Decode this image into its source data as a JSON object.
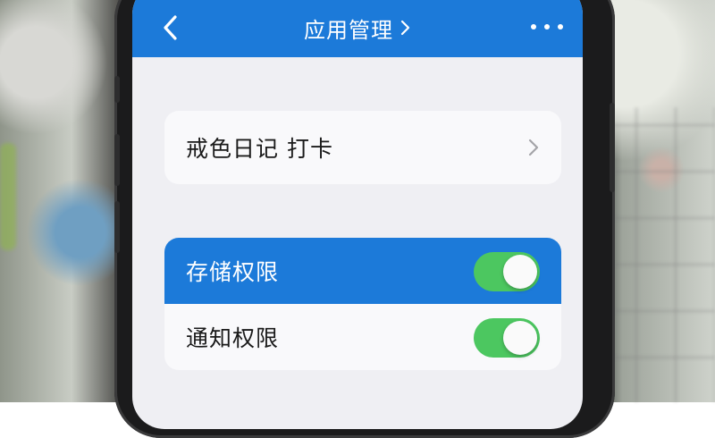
{
  "header": {
    "title": "应用管理",
    "back_icon": "chevron-left-icon",
    "title_icon": "chevron-right-icon",
    "more_icon": "more-horizontal-icon",
    "color": "#1c7ad9"
  },
  "app_row": {
    "label": "戒色日记 打卡",
    "chevron_icon": "chevron-right-icon"
  },
  "permissions": {
    "items": [
      {
        "label": "存储权限",
        "enabled": true,
        "highlighted": true
      },
      {
        "label": "通知权限",
        "enabled": true,
        "highlighted": false
      }
    ],
    "toggle_on_color": "#4cc760"
  }
}
